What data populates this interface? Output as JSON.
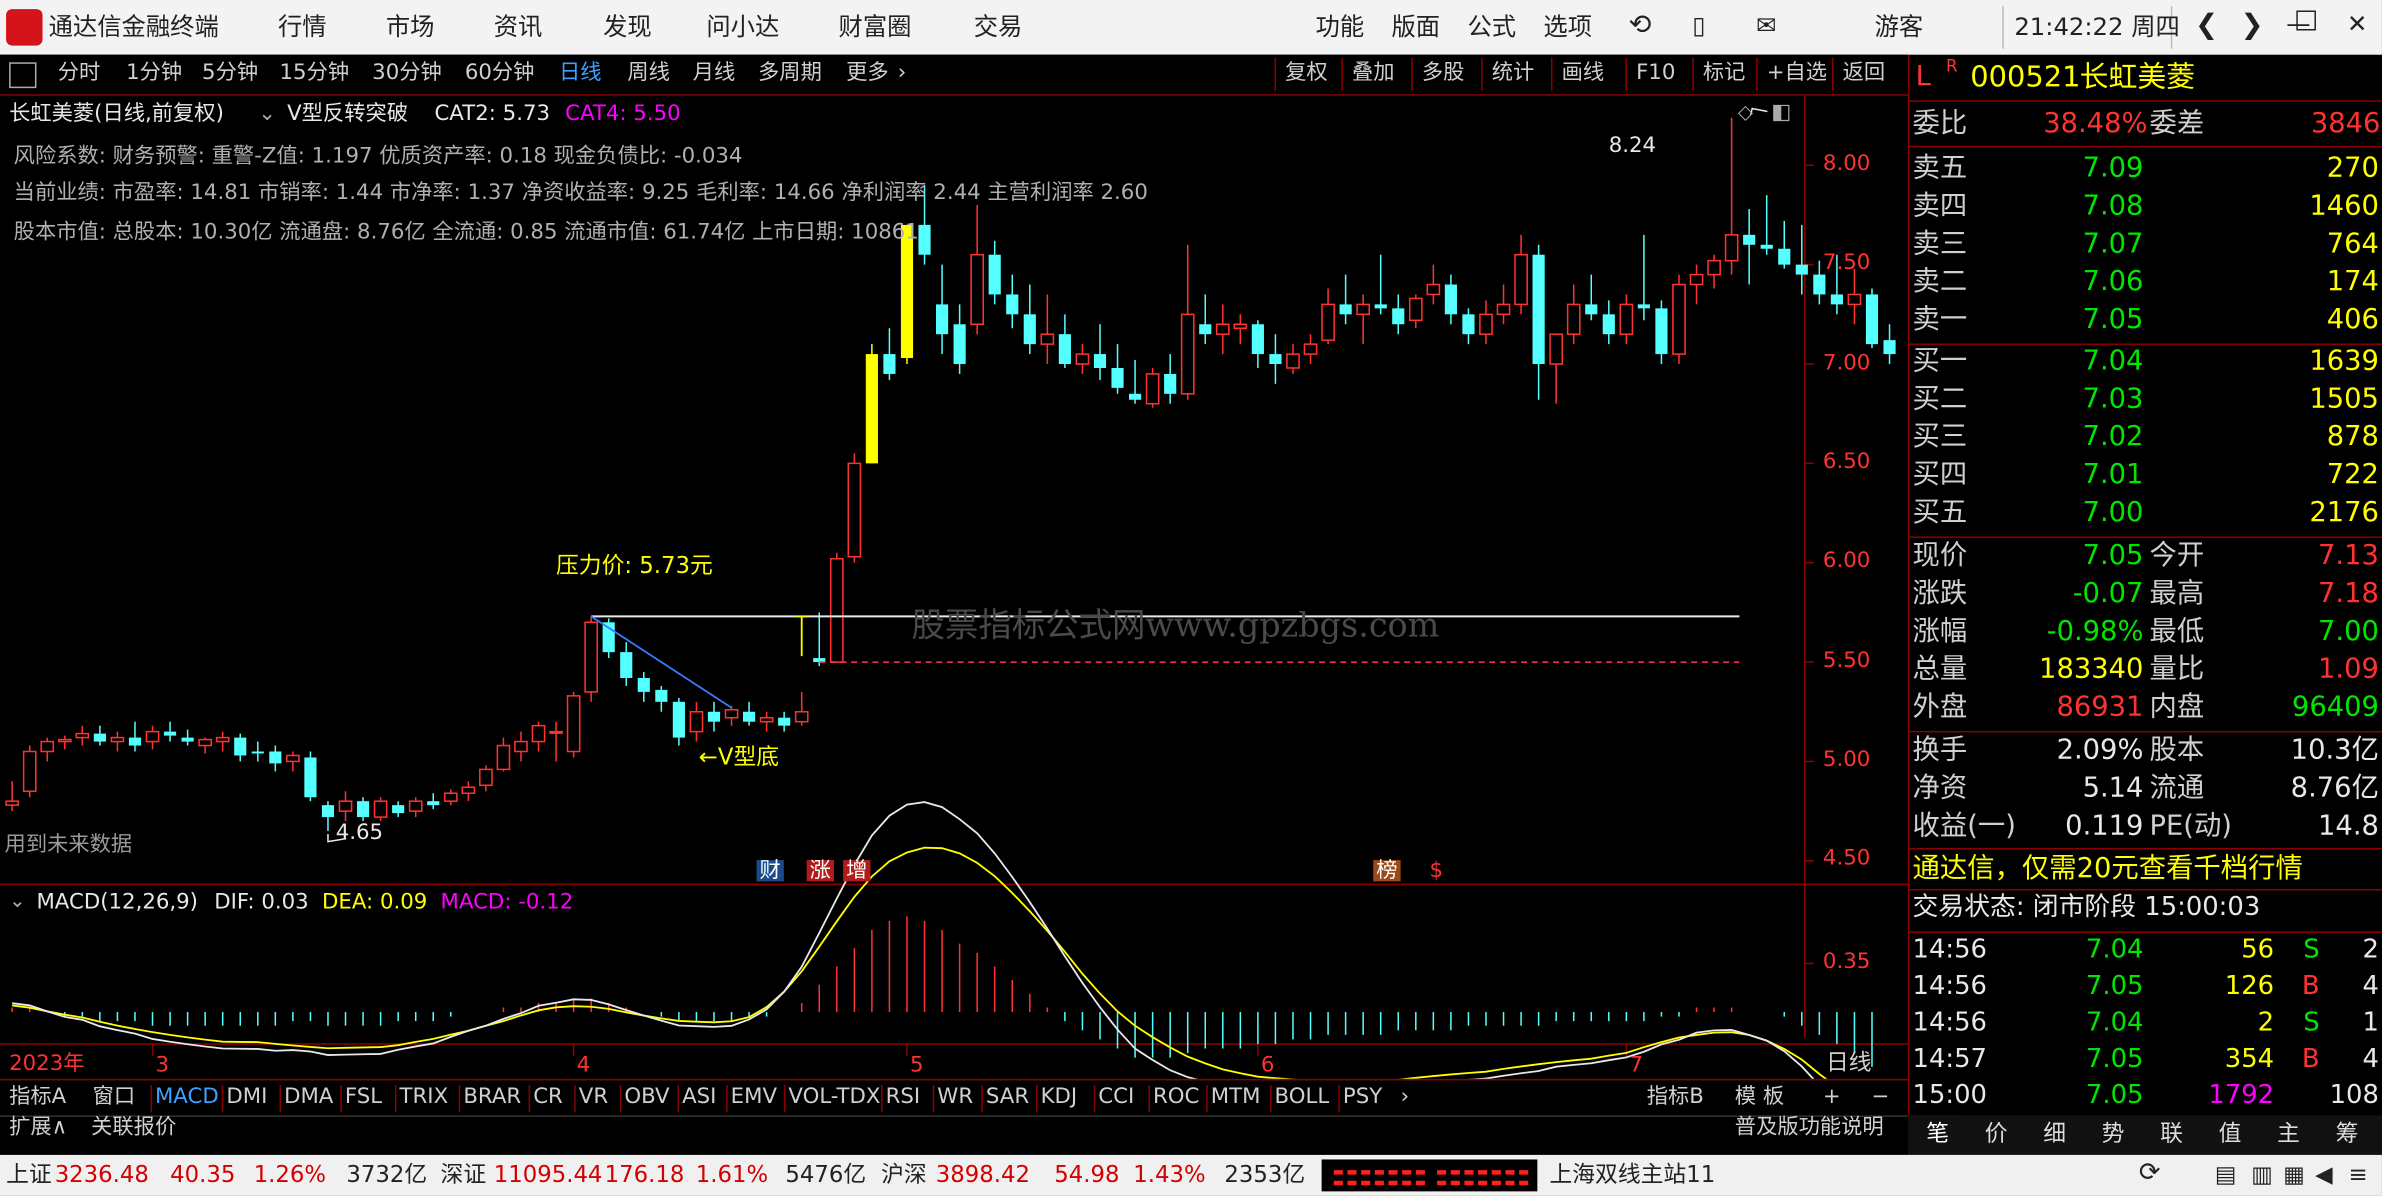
{
  "app": {
    "name": "通达信金融终端",
    "menus": [
      "行情",
      "市场",
      "资讯",
      "发现",
      "问小达",
      "财富圈",
      "交易"
    ],
    "right_menus": [
      "功能",
      "版面",
      "公式",
      "选项"
    ],
    "user": "游客",
    "clock": "21:42:22 周四"
  },
  "toolbar": {
    "periods": [
      "分时",
      "1分钟",
      "5分钟",
      "15分钟",
      "30分钟",
      "60分钟",
      "日线",
      "周线",
      "月线",
      "多周期",
      "更多"
    ],
    "active": "日线",
    "actions": [
      "复权",
      "叠加",
      "多股",
      "统计",
      "画线",
      "F10",
      "标记",
      "+自选",
      "返回"
    ]
  },
  "chart_header": {
    "title": "长虹美菱(日线,前复权)",
    "indicator": "V型反转突破",
    "cat2": "CAT2: 5.73",
    "cat4": "CAT4: 5.50"
  },
  "info": {
    "line1": "风险系数: 财务预警: 重警-Z值: 1.197 优质资产率: 0.18 现金负债比: -0.034",
    "line2": "当前业绩: 市盈率: 14.81 市销率: 1.44 市净率: 1.37 净资收益率: 9.25 毛利率: 14.66 净利润率 2.44 主营利润率 2.60",
    "line3": "股本市值: 总股本: 10.30亿 流通盘: 8.76亿 全流通: 0.85 流通市值: 61.74亿 上市日期: 10861"
  },
  "annotations": {
    "pressure": "压力价: 5.73元",
    "v_bottom": "←V型底",
    "high": "8.24",
    "low": "4.65",
    "future": "用到未来数据",
    "watermark": "股票指标公式网www.gpzbgs.com",
    "tags": [
      "财",
      "涨",
      "增",
      "榜",
      "$"
    ]
  },
  "price_axis": [
    "8.00",
    "7.50",
    "7.00",
    "6.50",
    "6.00",
    "5.50",
    "5.00",
    "4.50"
  ],
  "macd": {
    "label": "MACD(12,26,9)",
    "dif": "DIF: 0.03",
    "dea": "DEA: 0.09",
    "macd": "MACD: -0.12",
    "axis": "0.35"
  },
  "date_axis": {
    "year": "2023年",
    "months": [
      "3",
      "4",
      "5",
      "6",
      "7"
    ],
    "period": "日线"
  },
  "chart_data": {
    "type": "candlestick",
    "ylim": [
      4.45,
      8.35
    ],
    "candles": [
      [
        4.78,
        4.9,
        4.75,
        4.8
      ],
      [
        4.85,
        5.08,
        4.82,
        5.05
      ],
      [
        5.05,
        5.12,
        5.0,
        5.1
      ],
      [
        5.1,
        5.13,
        5.06,
        5.11
      ],
      [
        5.12,
        5.18,
        5.08,
        5.14
      ],
      [
        5.14,
        5.18,
        5.08,
        5.1
      ],
      [
        5.1,
        5.15,
        5.05,
        5.12
      ],
      [
        5.12,
        5.2,
        5.05,
        5.08
      ],
      [
        5.1,
        5.18,
        5.06,
        5.15
      ],
      [
        5.15,
        5.2,
        5.1,
        5.13
      ],
      [
        5.12,
        5.16,
        5.08,
        5.1
      ],
      [
        5.08,
        5.12,
        5.04,
        5.11
      ],
      [
        5.1,
        5.15,
        5.05,
        5.12
      ],
      [
        5.12,
        5.14,
        5.0,
        5.03
      ],
      [
        5.05,
        5.1,
        5.0,
        5.04
      ],
      [
        5.05,
        5.08,
        4.95,
        4.99
      ],
      [
        5.0,
        5.05,
        4.95,
        5.03
      ],
      [
        5.02,
        5.05,
        4.8,
        4.82
      ],
      [
        4.78,
        4.8,
        4.65,
        4.72
      ],
      [
        4.75,
        4.85,
        4.7,
        4.8
      ],
      [
        4.8,
        4.82,
        4.7,
        4.72
      ],
      [
        4.72,
        4.82,
        4.7,
        4.8
      ],
      [
        4.78,
        4.8,
        4.72,
        4.74
      ],
      [
        4.75,
        4.82,
        4.72,
        4.8
      ],
      [
        4.8,
        4.84,
        4.76,
        4.78
      ],
      [
        4.8,
        4.86,
        4.78,
        4.84
      ],
      [
        4.84,
        4.9,
        4.8,
        4.87
      ],
      [
        4.88,
        4.98,
        4.85,
        4.96
      ],
      [
        4.96,
        5.12,
        4.95,
        5.08
      ],
      [
        5.05,
        5.15,
        5.0,
        5.1
      ],
      [
        5.1,
        5.2,
        5.05,
        5.18
      ],
      [
        5.15,
        5.2,
        5.0,
        5.15
      ],
      [
        5.05,
        5.35,
        5.02,
        5.33
      ],
      [
        5.35,
        5.73,
        5.3,
        5.7
      ],
      [
        5.7,
        5.72,
        5.52,
        5.55
      ],
      [
        5.55,
        5.6,
        5.38,
        5.42
      ],
      [
        5.42,
        5.45,
        5.3,
        5.35
      ],
      [
        5.36,
        5.38,
        5.25,
        5.3
      ],
      [
        5.3,
        5.32,
        5.08,
        5.12
      ],
      [
        5.15,
        5.3,
        5.1,
        5.25
      ],
      [
        5.25,
        5.3,
        5.15,
        5.2
      ],
      [
        5.22,
        5.28,
        5.18,
        5.26
      ],
      [
        5.25,
        5.3,
        5.18,
        5.2
      ],
      [
        5.2,
        5.25,
        5.15,
        5.22
      ],
      [
        5.22,
        5.25,
        5.15,
        5.18
      ],
      [
        5.2,
        5.35,
        5.18,
        5.25
      ],
      [
        5.52,
        5.75,
        5.48,
        5.5
      ],
      [
        5.5,
        6.05,
        5.5,
        6.02
      ],
      [
        6.03,
        6.55,
        6.0,
        6.5
      ],
      [
        6.5,
        7.1,
        6.5,
        7.05
      ],
      [
        7.05,
        7.18,
        6.92,
        6.95
      ],
      [
        7.03,
        7.7,
        7.0,
        7.7
      ],
      [
        7.7,
        7.9,
        7.5,
        7.55
      ],
      [
        7.3,
        7.5,
        7.05,
        7.15
      ],
      [
        7.2,
        7.3,
        6.95,
        7.0
      ],
      [
        7.2,
        7.8,
        7.15,
        7.55
      ],
      [
        7.55,
        7.62,
        7.3,
        7.35
      ],
      [
        7.35,
        7.45,
        7.18,
        7.25
      ],
      [
        7.25,
        7.4,
        7.05,
        7.1
      ],
      [
        7.1,
        7.35,
        7.0,
        7.15
      ],
      [
        7.15,
        7.25,
        6.98,
        7.0
      ],
      [
        7.0,
        7.1,
        6.95,
        7.05
      ],
      [
        7.05,
        7.2,
        6.92,
        6.98
      ],
      [
        6.98,
        7.1,
        6.85,
        6.88
      ],
      [
        6.85,
        7.02,
        6.8,
        6.82
      ],
      [
        6.8,
        6.98,
        6.78,
        6.95
      ],
      [
        6.95,
        7.05,
        6.8,
        6.85
      ],
      [
        6.85,
        7.6,
        6.82,
        7.25
      ],
      [
        7.2,
        7.35,
        7.1,
        7.15
      ],
      [
        7.15,
        7.3,
        7.05,
        7.2
      ],
      [
        7.18,
        7.25,
        7.1,
        7.2
      ],
      [
        7.2,
        7.22,
        6.98,
        7.05
      ],
      [
        7.05,
        7.15,
        6.9,
        7.0
      ],
      [
        6.98,
        7.1,
        6.95,
        7.05
      ],
      [
        7.05,
        7.15,
        7.0,
        7.1
      ],
      [
        7.12,
        7.38,
        7.1,
        7.3
      ],
      [
        7.3,
        7.45,
        7.2,
        7.25
      ],
      [
        7.25,
        7.35,
        7.1,
        7.3
      ],
      [
        7.3,
        7.55,
        7.25,
        7.28
      ],
      [
        7.28,
        7.35,
        7.15,
        7.2
      ],
      [
        7.22,
        7.35,
        7.18,
        7.33
      ],
      [
        7.35,
        7.5,
        7.3,
        7.4
      ],
      [
        7.4,
        7.45,
        7.2,
        7.25
      ],
      [
        7.25,
        7.28,
        7.1,
        7.15
      ],
      [
        7.15,
        7.32,
        7.1,
        7.25
      ],
      [
        7.25,
        7.4,
        7.2,
        7.3
      ],
      [
        7.3,
        7.65,
        7.25,
        7.55
      ],
      [
        7.55,
        7.6,
        6.82,
        7.0
      ],
      [
        7.0,
        7.15,
        6.8,
        7.15
      ],
      [
        7.15,
        7.4,
        7.1,
        7.3
      ],
      [
        7.3,
        7.45,
        7.22,
        7.25
      ],
      [
        7.25,
        7.32,
        7.1,
        7.15
      ],
      [
        7.15,
        7.35,
        7.1,
        7.3
      ],
      [
        7.3,
        7.65,
        7.22,
        7.28
      ],
      [
        7.28,
        7.32,
        7.0,
        7.05
      ],
      [
        7.05,
        7.45,
        7.0,
        7.4
      ],
      [
        7.4,
        7.5,
        7.3,
        7.45
      ],
      [
        7.45,
        7.55,
        7.38,
        7.52
      ],
      [
        7.52,
        8.24,
        7.45,
        7.65
      ],
      [
        7.65,
        7.78,
        7.4,
        7.6
      ],
      [
        7.6,
        7.85,
        7.55,
        7.58
      ],
      [
        7.58,
        7.72,
        7.48,
        7.5
      ],
      [
        7.5,
        7.7,
        7.35,
        7.45
      ],
      [
        7.45,
        7.52,
        7.3,
        7.35
      ],
      [
        7.35,
        7.55,
        7.25,
        7.3
      ],
      [
        7.3,
        7.48,
        7.2,
        7.35
      ],
      [
        7.35,
        7.38,
        7.08,
        7.1
      ],
      [
        7.12,
        7.2,
        7.0,
        7.05
      ]
    ],
    "macd_hist": [
      0.01,
      0.01,
      0.0,
      -0.01,
      -0.01,
      -0.02,
      -0.02,
      -0.02,
      -0.03,
      -0.03,
      -0.03,
      -0.03,
      -0.03,
      -0.03,
      -0.03,
      -0.03,
      -0.02,
      -0.02,
      -0.03,
      -0.03,
      -0.03,
      -0.03,
      -0.02,
      -0.02,
      -0.02,
      -0.01,
      0.0,
      0.0,
      0.01,
      0.01,
      0.02,
      0.02,
      0.03,
      0.03,
      0.02,
      0.01,
      0.0,
      -0.01,
      -0.02,
      -0.02,
      -0.02,
      -0.02,
      -0.01,
      -0.01,
      0.0,
      0.02,
      0.06,
      0.1,
      0.14,
      0.18,
      0.2,
      0.21,
      0.2,
      0.18,
      0.15,
      0.13,
      0.1,
      0.07,
      0.04,
      0.01,
      -0.02,
      -0.04,
      -0.06,
      -0.08,
      -0.1,
      -0.1,
      -0.1,
      -0.09,
      -0.08,
      -0.08,
      -0.08,
      -0.07,
      -0.07,
      -0.06,
      -0.06,
      -0.05,
      -0.05,
      -0.05,
      -0.05,
      -0.04,
      -0.04,
      -0.04,
      -0.04,
      -0.03,
      -0.03,
      -0.03,
      -0.03,
      -0.03,
      -0.02,
      -0.02,
      -0.02,
      -0.02,
      -0.02,
      -0.02,
      -0.01,
      -0.01,
      0.01,
      0.01,
      0.01,
      0.0,
      0.0,
      -0.01,
      -0.03,
      -0.05,
      -0.07,
      -0.09,
      -0.12
    ]
  },
  "quote": {
    "code": "000521",
    "name": "长虹美菱",
    "weibi": [
      "委比",
      "38.48%",
      "委差",
      "3846"
    ],
    "asks": [
      [
        "卖五",
        "7.09",
        "270"
      ],
      [
        "卖四",
        "7.08",
        "1460"
      ],
      [
        "卖三",
        "7.07",
        "764"
      ],
      [
        "卖二",
        "7.06",
        "174"
      ],
      [
        "卖一",
        "7.05",
        "406"
      ]
    ],
    "bids": [
      [
        "买一",
        "7.04",
        "1639"
      ],
      [
        "买二",
        "7.03",
        "1505"
      ],
      [
        "买三",
        "7.02",
        "878"
      ],
      [
        "买四",
        "7.01",
        "722"
      ],
      [
        "买五",
        "7.00",
        "2176"
      ]
    ],
    "stats": [
      [
        "现价",
        "7.05",
        "今开",
        "7.13"
      ],
      [
        "涨跌",
        "-0.07",
        "最高",
        "7.18"
      ],
      [
        "涨幅",
        "-0.98%",
        "最低",
        "7.00"
      ],
      [
        "总量",
        "183340",
        "量比",
        "1.09"
      ],
      [
        "外盘",
        "86931",
        "内盘",
        "96409"
      ]
    ],
    "stats2": [
      [
        "换手",
        "2.09%",
        "股本",
        "10.3亿"
      ],
      [
        "净资",
        "5.14",
        "流通",
        "8.76亿"
      ],
      [
        "收益(一)",
        "0.119",
        "PE(动)",
        "14.8"
      ]
    ],
    "ad": "通达信，仅需20元查看千档行情",
    "trade_state": "交易状态: 闭市阶段 15:00:03",
    "ticks": [
      [
        "14:56",
        "7.04",
        "56",
        "S",
        "2"
      ],
      [
        "14:56",
        "7.05",
        "126",
        "B",
        "4"
      ],
      [
        "14:56",
        "7.04",
        "2",
        "S",
        "1"
      ],
      [
        "14:57",
        "7.05",
        "354",
        "B",
        "4"
      ],
      [
        "15:00",
        "7.05",
        "1792",
        "",
        "108"
      ]
    ]
  },
  "indicators": {
    "left": [
      "指标A",
      "窗口"
    ],
    "items": [
      "MACD",
      "DMI",
      "DMA",
      "FSL",
      "TRIX",
      "BRAR",
      "CR",
      "VR",
      "OBV",
      "ASI",
      "EMV",
      "VOL-TDX",
      "RSI",
      "WR",
      "SAR",
      "KDJ",
      "CCI",
      "ROC",
      "MTM",
      "BOLL",
      "PSY"
    ],
    "right": [
      "指标B",
      "模 板",
      "+",
      "−"
    ]
  },
  "ext": {
    "left": [
      "扩展∧",
      "关联报价"
    ],
    "right": "普及版功能说明"
  },
  "rtabs": [
    "笔",
    "价",
    "细",
    "势",
    "联",
    "值",
    "主",
    "筹"
  ],
  "status": {
    "sh": [
      "上证",
      "3236.48",
      "40.35",
      "1.26%",
      "3732亿"
    ],
    "sz": [
      "深证",
      "11095.44",
      "176.18",
      "1.61%",
      "5476亿"
    ],
    "hs": [
      "沪深",
      "3898.42",
      "54.98",
      "1.43%",
      "2353亿"
    ],
    "station": "上海双线主站11"
  }
}
